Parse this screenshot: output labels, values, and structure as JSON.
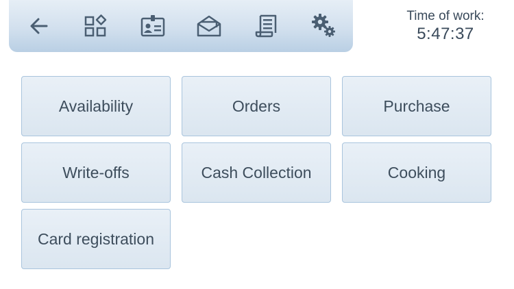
{
  "toolbar": {
    "icons": [
      {
        "name": "back-arrow-icon"
      },
      {
        "name": "apps-grid-icon"
      },
      {
        "name": "id-badge-icon"
      },
      {
        "name": "open-mail-icon"
      },
      {
        "name": "receipt-icon"
      },
      {
        "name": "gears-icon"
      }
    ],
    "icon_color": "#4a5e72"
  },
  "timer": {
    "label": "Time of work:",
    "value": "5:47:37"
  },
  "tiles": [
    {
      "label": "Availability"
    },
    {
      "label": "Orders"
    },
    {
      "label": "Purchase"
    },
    {
      "label": "Write-offs"
    },
    {
      "label": "Cash Collection"
    },
    {
      "label": "Cooking"
    },
    {
      "label": "Card registration"
    }
  ]
}
